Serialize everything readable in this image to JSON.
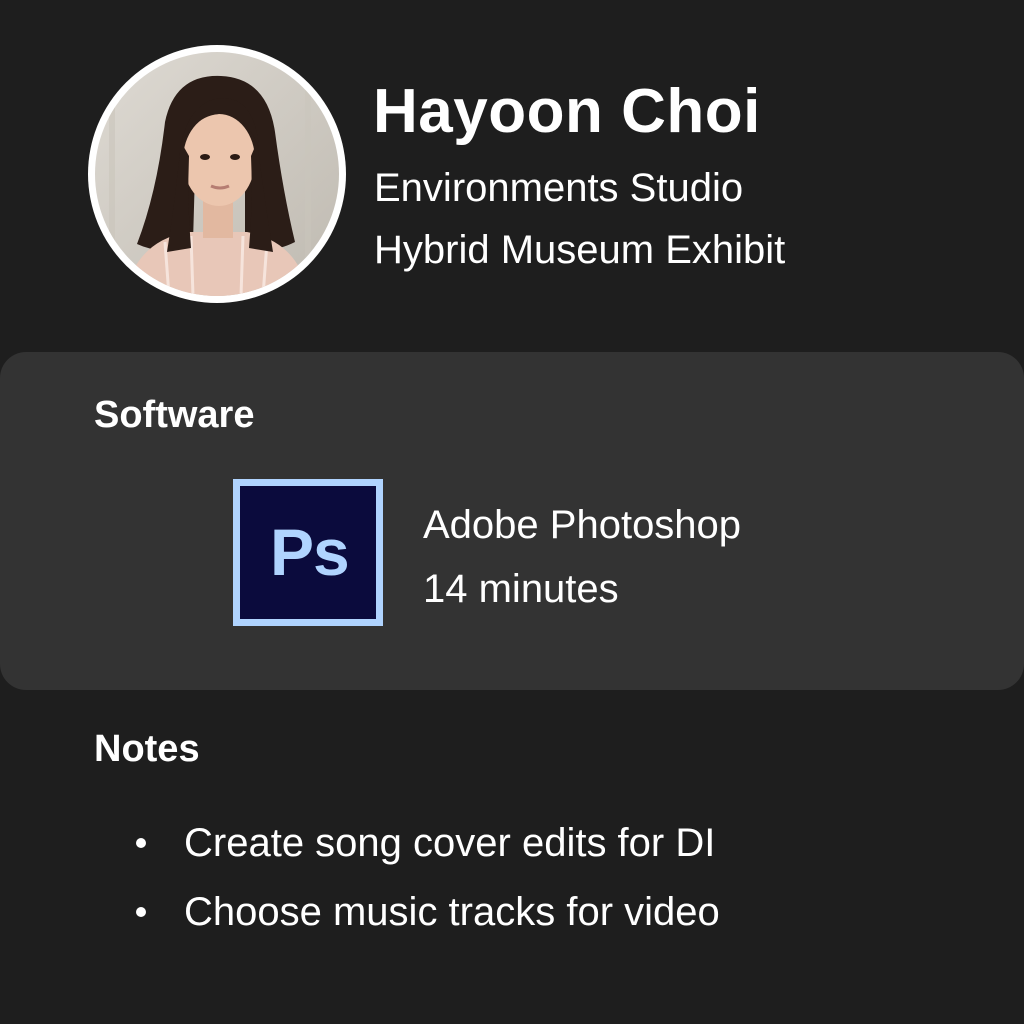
{
  "profile": {
    "name": "Hayoon Choi",
    "studio": "Environments Studio",
    "project": "Hybrid Museum Exhibit",
    "avatar_icon": "profile-photo"
  },
  "software": {
    "title": "Software",
    "items": [
      {
        "icon": "photoshop-icon",
        "icon_label": "Ps",
        "name": "Adobe Photoshop",
        "duration": "14 minutes",
        "icon_colors": {
          "frame": "#b0d4ff",
          "fill": "#0b0b3d",
          "text": "#b0d4ff"
        }
      }
    ]
  },
  "notes": {
    "title": "Notes",
    "items": [
      "Create song cover edits for DI",
      "Choose music tracks for video"
    ]
  },
  "colors": {
    "background": "#1e1e1e",
    "card": "#333333",
    "text": "#ffffff"
  }
}
